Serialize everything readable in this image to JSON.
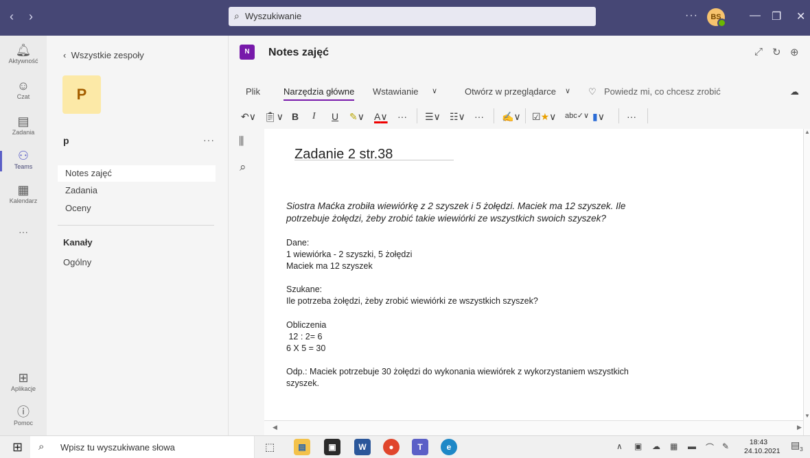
{
  "titlebar": {
    "search_placeholder": "Wyszukiwanie",
    "more": "···",
    "avatar_initials": "BS"
  },
  "rail": {
    "items": [
      {
        "label": "Aktywność",
        "icon": "bell-icon"
      },
      {
        "label": "Czat",
        "icon": "chat-icon"
      },
      {
        "label": "Zadania",
        "icon": "assignments-icon"
      },
      {
        "label": "Teams",
        "icon": "teams-icon"
      },
      {
        "label": "Kalendarz",
        "icon": "calendar-icon"
      },
      {
        "label": "···",
        "icon": "more-icon"
      },
      {
        "label": "Aplikacje",
        "icon": "apps-icon"
      },
      {
        "label": "Pomoc",
        "icon": "help-icon"
      }
    ]
  },
  "panel": {
    "back_label": "Wszystkie zespoły",
    "team_initial": "P",
    "team_name": "p",
    "team_more": "···",
    "links": [
      "Notes zajęć",
      "Zadania",
      "Oceny"
    ],
    "channels_label": "Kanały",
    "channel_general": "Ogólny"
  },
  "app": {
    "logo": "N",
    "title": "Notes zajęć"
  },
  "ribbon": {
    "tabs": [
      "Plik",
      "Narzędzia główne",
      "Wstawianie",
      "Otwórz w przeglądarce"
    ],
    "tell_me": "Powiedz mi, co chcesz zrobić",
    "bold": "B",
    "italic": "I",
    "underline": "U",
    "font_color": "A",
    "more": "···"
  },
  "page": {
    "title": "Zadanie 2 str.38",
    "problem_line1": "Siostra Maćka zrobiła wiewiórkę z 2 szyszek i 5 żołędzi. Maciek ma 12 szyszek. Ile",
    "problem_line2": "potrzebuje żołędzi, żeby zrobić takie wiewiórki ze wszystkich swoich szyszek?",
    "given_label": "Dane:",
    "given_1": "1 wiewiórka - 2 szyszki, 5 żołędzi",
    "given_2": "Maciek ma 12 szyszek",
    "sought_label": "Szukane:",
    "sought_1": "Ile potrzeba żołędzi, żeby zrobić wiewiórki ze wszystkich szyszek?",
    "calc_label": "Obliczenia",
    "calc_1": " 12 : 2= 6",
    "calc_2": "6 X 5 = 30",
    "answer_line1": "Odp.: Maciek potrzebuje 30 żołędzi do wykonania wiewiórek z wykorzystaniem wszystkich",
    "answer_line2": "szyszek."
  },
  "taskbar": {
    "search_placeholder": "Wpisz tu wyszukiwane słowa",
    "time": "18:43",
    "date": "24.10.2021",
    "notifications": "3"
  },
  "colors": {
    "titlebar": "#464775",
    "accent": "#5b5fc7",
    "onenote": "#7719aa"
  }
}
